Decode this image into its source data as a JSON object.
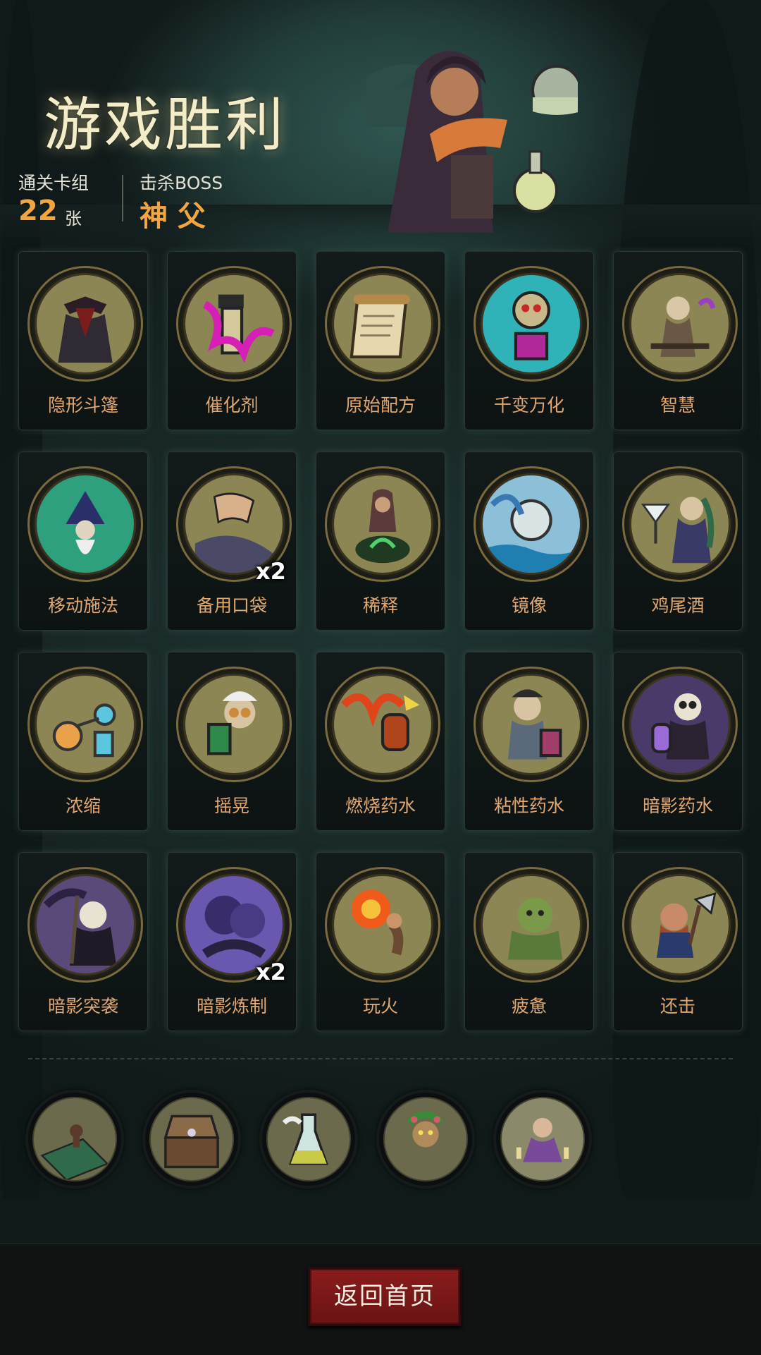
{
  "header": {
    "title": "游戏胜利",
    "deck_label": "通关卡组",
    "deck_count": "22",
    "deck_unit": "张",
    "boss_label": "击杀BOSS",
    "boss_name": "神 父"
  },
  "cards": [
    {
      "name": "隐形斗篷",
      "icon": "cloak-icon"
    },
    {
      "name": "催化剂",
      "icon": "catalyst-icon"
    },
    {
      "name": "原始配方",
      "icon": "scroll-icon"
    },
    {
      "name": "千变万化",
      "icon": "jack-in-box-icon"
    },
    {
      "name": "智慧",
      "icon": "old-sage-icon"
    },
    {
      "name": "移动施法",
      "icon": "wizard-icon"
    },
    {
      "name": "备用口袋",
      "icon": "pocket-hand-icon",
      "badge": "x2"
    },
    {
      "name": "稀释",
      "icon": "cauldron-icon"
    },
    {
      "name": "镜像",
      "icon": "orb-icon"
    },
    {
      "name": "鸡尾酒",
      "icon": "cocktail-icon"
    },
    {
      "name": "浓缩",
      "icon": "distill-flask-icon"
    },
    {
      "name": "摇晃",
      "icon": "mad-scientist-icon"
    },
    {
      "name": "燃烧药水",
      "icon": "fire-potion-icon"
    },
    {
      "name": "粘性药水",
      "icon": "alchemist-icon"
    },
    {
      "name": "暗影药水",
      "icon": "skeleton-potion-icon"
    },
    {
      "name": "暗影突袭",
      "icon": "reaper-icon"
    },
    {
      "name": "暗影炼制",
      "icon": "shadow-cloud-icon",
      "badge": "x2"
    },
    {
      "name": "玩火",
      "icon": "fire-play-icon"
    },
    {
      "name": "疲惫",
      "icon": "ogre-icon"
    },
    {
      "name": "还击",
      "icon": "dwarf-axe-icon"
    }
  ],
  "relics": [
    {
      "icon": "chess-board-icon"
    },
    {
      "icon": "music-box-icon"
    },
    {
      "icon": "potion-flask-icon"
    },
    {
      "icon": "dryad-icon"
    },
    {
      "icon": "meditation-icon"
    }
  ],
  "footer": {
    "home_button": "返回首页"
  },
  "colors": {
    "accent": "#f2a541",
    "card_name": "#e2a871",
    "button": "#8a1c1c"
  }
}
